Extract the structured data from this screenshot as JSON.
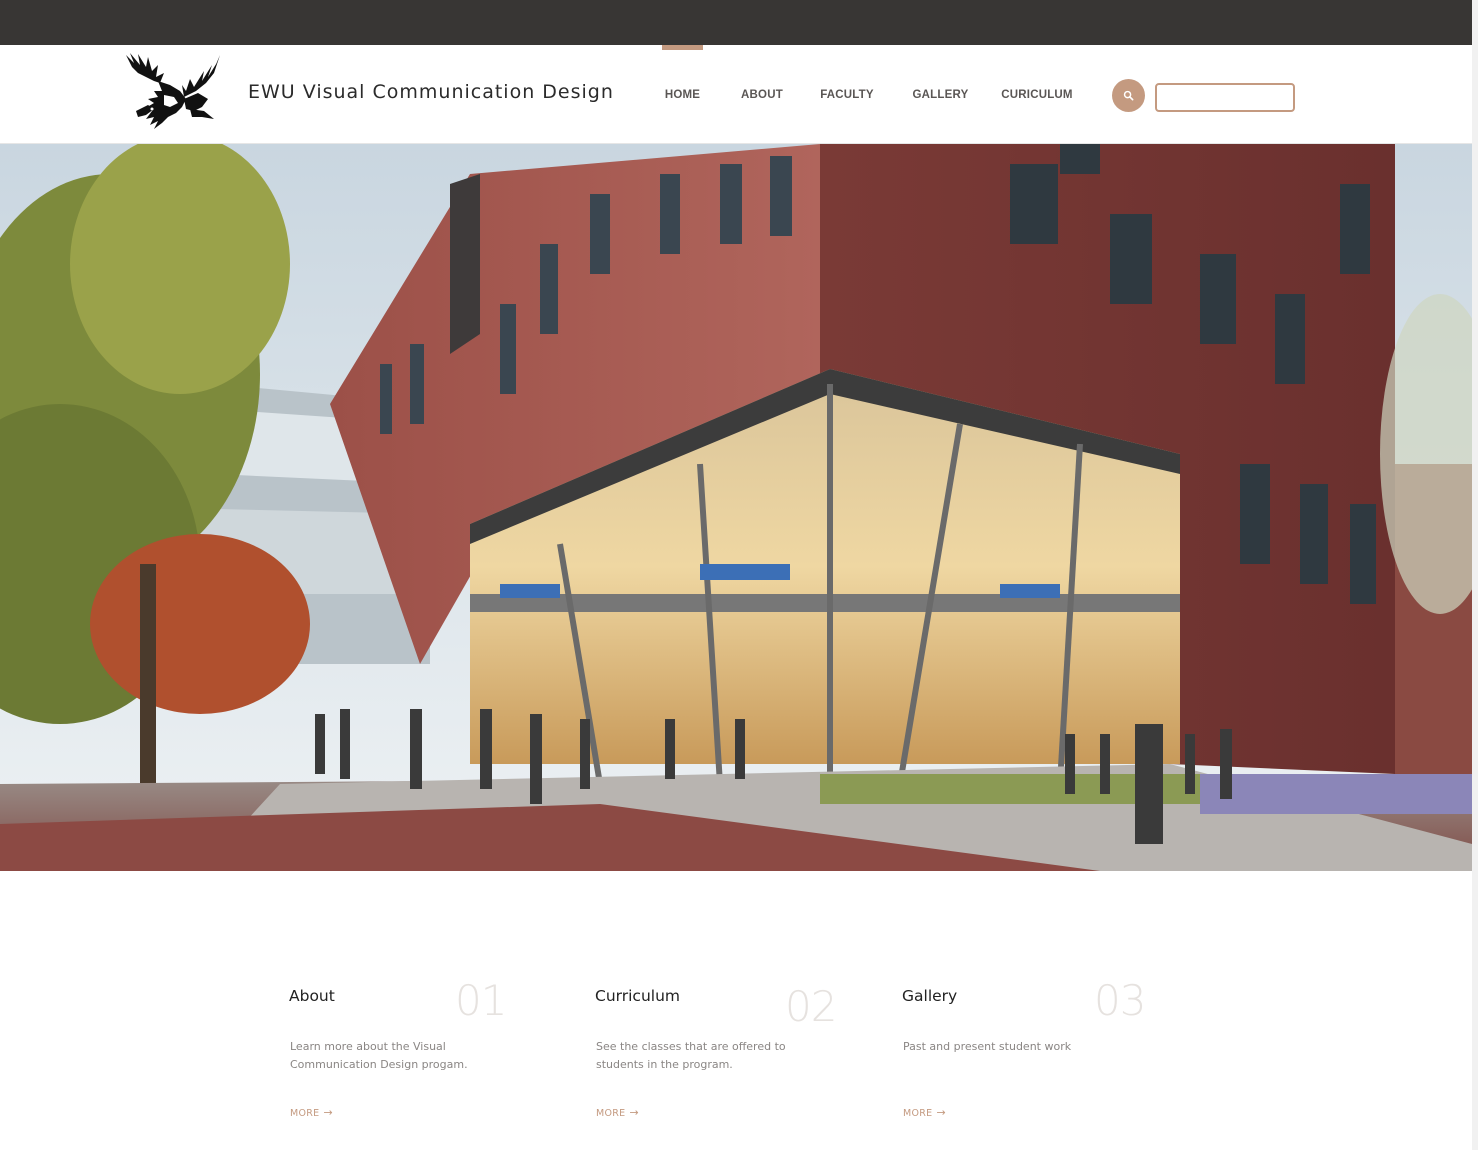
{
  "site": {
    "title": "EWU Visual Communication Design"
  },
  "nav": {
    "items": [
      {
        "label": "HOME",
        "active": true
      },
      {
        "label": "ABOUT",
        "active": false
      },
      {
        "label": "FACULTY",
        "active": false
      },
      {
        "label": "GALLERY",
        "active": false
      },
      {
        "label": "CURICULUM",
        "active": false
      }
    ]
  },
  "search": {
    "icon": "search-icon",
    "value": "",
    "placeholder": ""
  },
  "hero": {
    "image": "campus-building-rendering"
  },
  "features": [
    {
      "title": "About",
      "number": "01",
      "description": "Learn more about the Visual Communication Design progam.",
      "more": "MORE"
    },
    {
      "title": "Curriculum",
      "number": "02",
      "description": "See the classes that are offered to students in the program.",
      "more": "MORE"
    },
    {
      "title": "Gallery",
      "number": "03",
      "description": "Past and present student work",
      "more": "MORE"
    }
  ],
  "colors": {
    "accent": "#c49a80",
    "topbar": "#383634",
    "nav_text": "#5a5654"
  }
}
